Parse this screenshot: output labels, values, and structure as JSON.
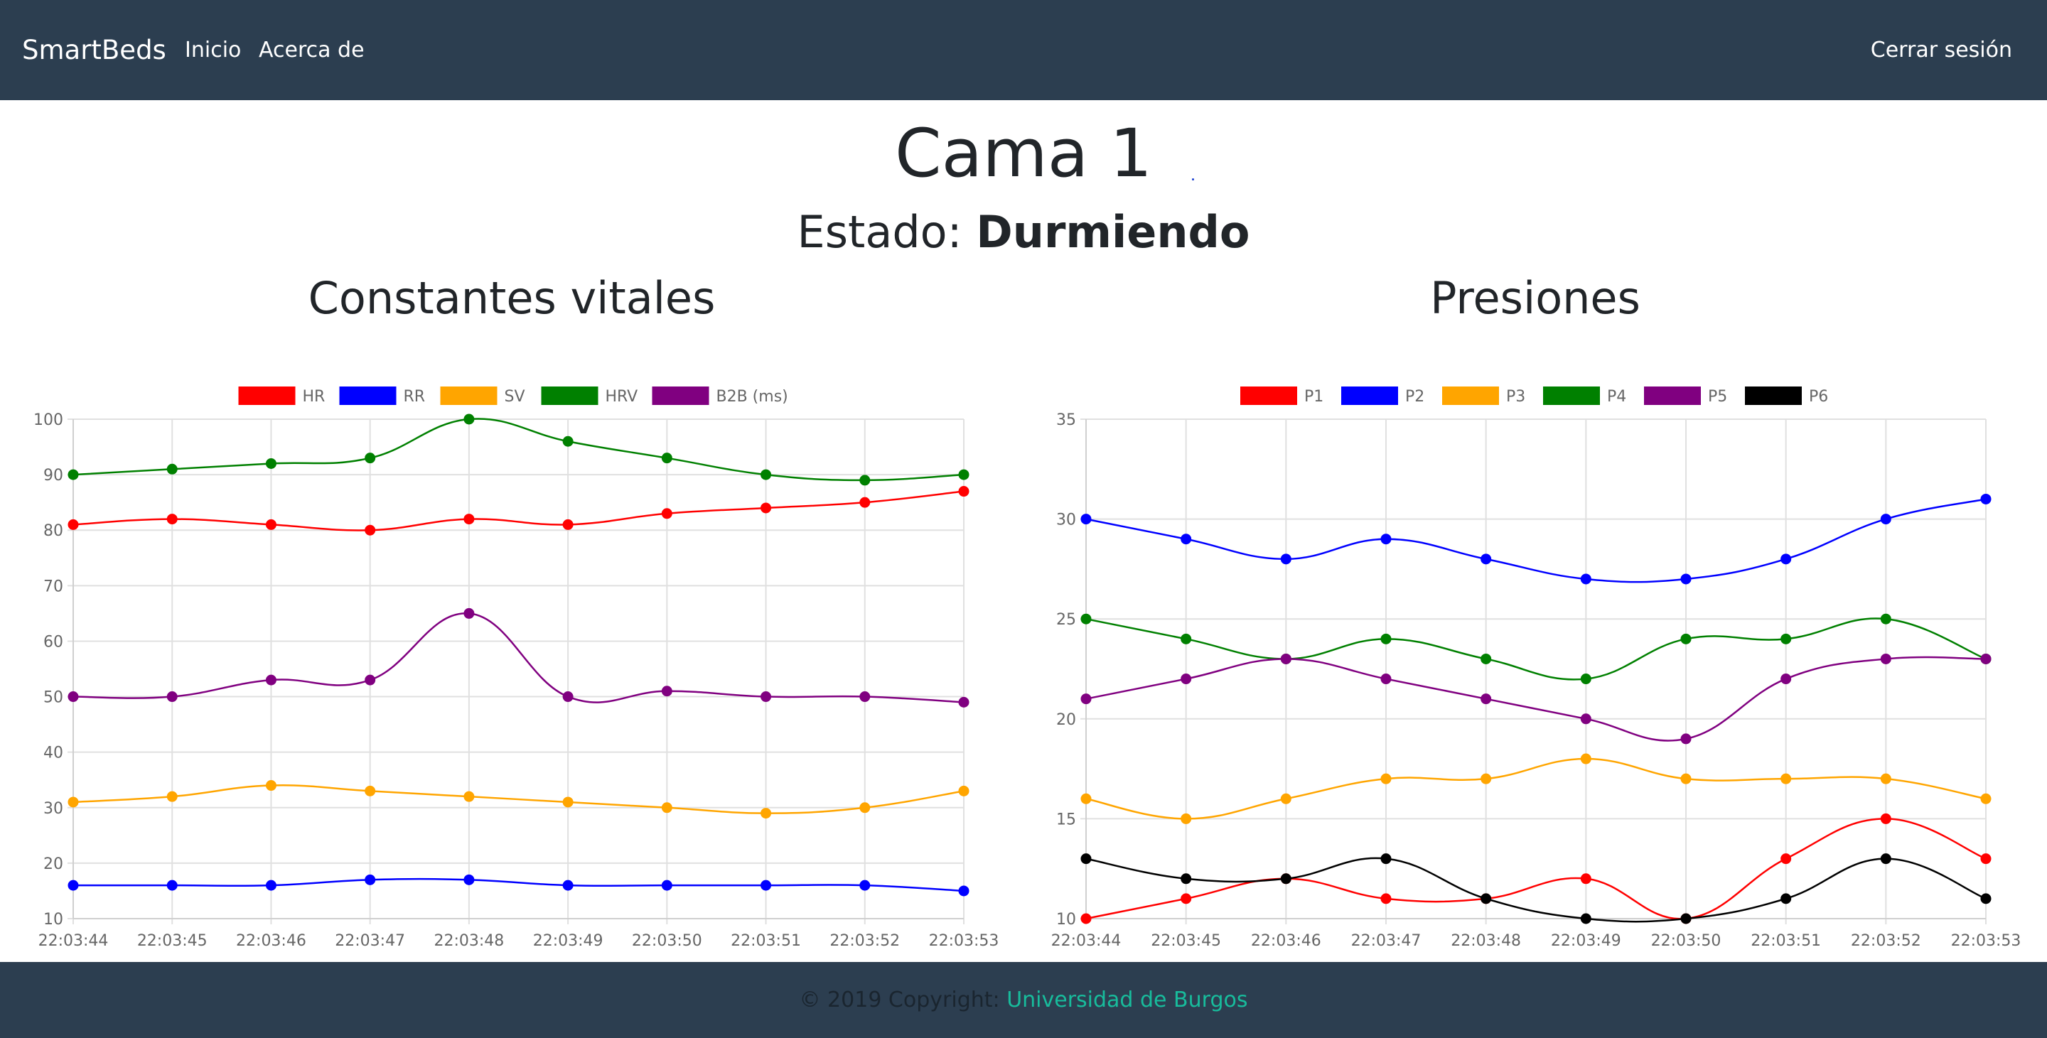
{
  "navbar": {
    "brand": "SmartBeds",
    "links": [
      "Inicio",
      "Acerca de"
    ],
    "logout": "Cerrar sesión"
  },
  "page": {
    "title": "Cama 1",
    "estado_label": "Estado:",
    "estado_value": "Durmiendo",
    "left_heading": "Constantes vitales",
    "right_heading": "Presiones"
  },
  "footer": {
    "copyright": "© 2019 Copyright:",
    "link": "Universidad de Burgos"
  },
  "colors": {
    "navbar_bg": "#2c3e50",
    "footer_link": "#18bc9c"
  },
  "chart_data": [
    {
      "type": "line",
      "categories": [
        "22:03:44",
        "22:03:45",
        "22:03:46",
        "22:03:47",
        "22:03:48",
        "22:03:49",
        "22:03:50",
        "22:03:51",
        "22:03:52",
        "22:03:53"
      ],
      "ylim": [
        10,
        100
      ],
      "yticks": [
        10,
        20,
        30,
        40,
        50,
        60,
        70,
        80,
        90,
        100
      ],
      "grid": true,
      "legend": "top",
      "series": [
        {
          "name": "HR",
          "color": "#ff0000",
          "values": [
            81,
            82,
            81,
            80,
            82,
            81,
            83,
            84,
            85,
            87
          ]
        },
        {
          "name": "RR",
          "color": "#0000ff",
          "values": [
            16,
            16,
            16,
            17,
            17,
            16,
            16,
            16,
            16,
            15
          ]
        },
        {
          "name": "SV",
          "color": "#ffa500",
          "values": [
            31,
            32,
            34,
            33,
            32,
            31,
            30,
            29,
            30,
            33
          ]
        },
        {
          "name": "HRV",
          "color": "#008000",
          "values": [
            90,
            91,
            92,
            93,
            100,
            96,
            93,
            90,
            89,
            90
          ]
        },
        {
          "name": "B2B (ms)",
          "color": "#800080",
          "values": [
            50,
            50,
            53,
            53,
            65,
            50,
            51,
            50,
            50,
            49
          ]
        }
      ]
    },
    {
      "type": "line",
      "categories": [
        "22:03:44",
        "22:03:45",
        "22:03:46",
        "22:03:47",
        "22:03:48",
        "22:03:49",
        "22:03:50",
        "22:03:51",
        "22:03:52",
        "22:03:53"
      ],
      "ylim": [
        10,
        35
      ],
      "yticks": [
        10,
        15,
        20,
        25,
        30,
        35
      ],
      "grid": true,
      "legend": "top",
      "series": [
        {
          "name": "P1",
          "color": "#ff0000",
          "values": [
            10,
            11,
            12,
            11,
            11,
            12,
            10,
            13,
            15,
            13
          ]
        },
        {
          "name": "P2",
          "color": "#0000ff",
          "values": [
            30,
            29,
            28,
            29,
            28,
            27,
            27,
            28,
            30,
            31
          ]
        },
        {
          "name": "P3",
          "color": "#ffa500",
          "values": [
            16,
            15,
            16,
            17,
            17,
            18,
            17,
            17,
            17,
            16
          ]
        },
        {
          "name": "P4",
          "color": "#008000",
          "values": [
            25,
            24,
            23,
            24,
            23,
            22,
            24,
            24,
            25,
            23
          ]
        },
        {
          "name": "P5",
          "color": "#800080",
          "values": [
            21,
            22,
            23,
            22,
            21,
            20,
            19,
            22,
            23,
            23
          ]
        },
        {
          "name": "P6",
          "color": "#000000",
          "values": [
            13,
            12,
            12,
            13,
            11,
            10,
            10,
            11,
            13,
            11
          ]
        }
      ]
    }
  ]
}
